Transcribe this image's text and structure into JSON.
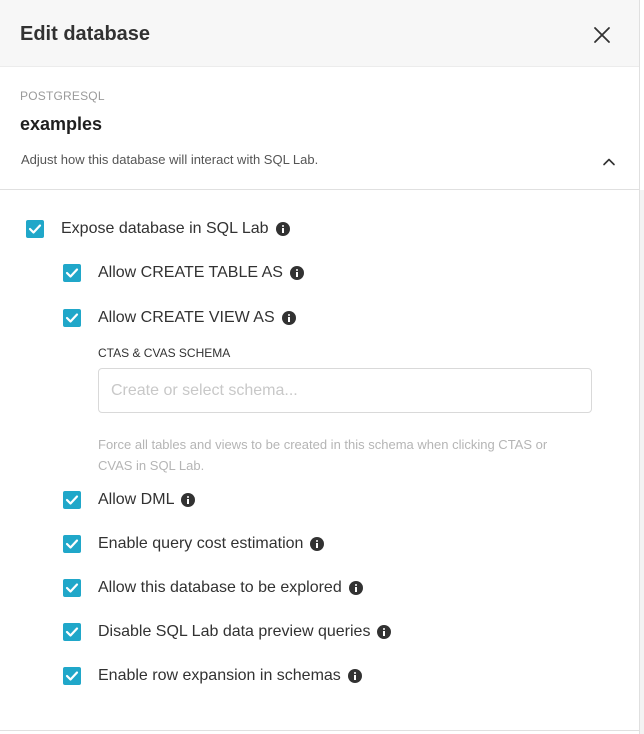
{
  "header": {
    "title": "Edit database"
  },
  "database": {
    "type": "POSTGRESQL",
    "name": "examples"
  },
  "section": {
    "description": "Adjust how this database will interact with SQL Lab."
  },
  "options": {
    "expose": {
      "label": "Expose database in SQL Lab",
      "checked": true
    },
    "create_table": {
      "label": "Allow CREATE TABLE AS",
      "checked": true
    },
    "create_view": {
      "label": "Allow CREATE VIEW AS",
      "checked": true
    },
    "schema": {
      "label": "CTAS & CVAS SCHEMA",
      "placeholder": "Create or select schema...",
      "value": "",
      "help": "Force all tables and views to be created in this schema when clicking CTAS or CVAS in SQL Lab."
    },
    "allow_dml": {
      "label": "Allow DML",
      "checked": true
    },
    "cost_estimation": {
      "label": "Enable query cost estimation",
      "checked": true
    },
    "explore": {
      "label": "Allow this database to be explored",
      "checked": true
    },
    "disable_preview": {
      "label": "Disable SQL Lab data preview queries",
      "checked": true
    },
    "row_expansion": {
      "label": "Enable row expansion in schemas",
      "checked": true
    }
  },
  "colors": {
    "checkbox": "#20a7c9",
    "header_bg": "#f7f7f7"
  }
}
